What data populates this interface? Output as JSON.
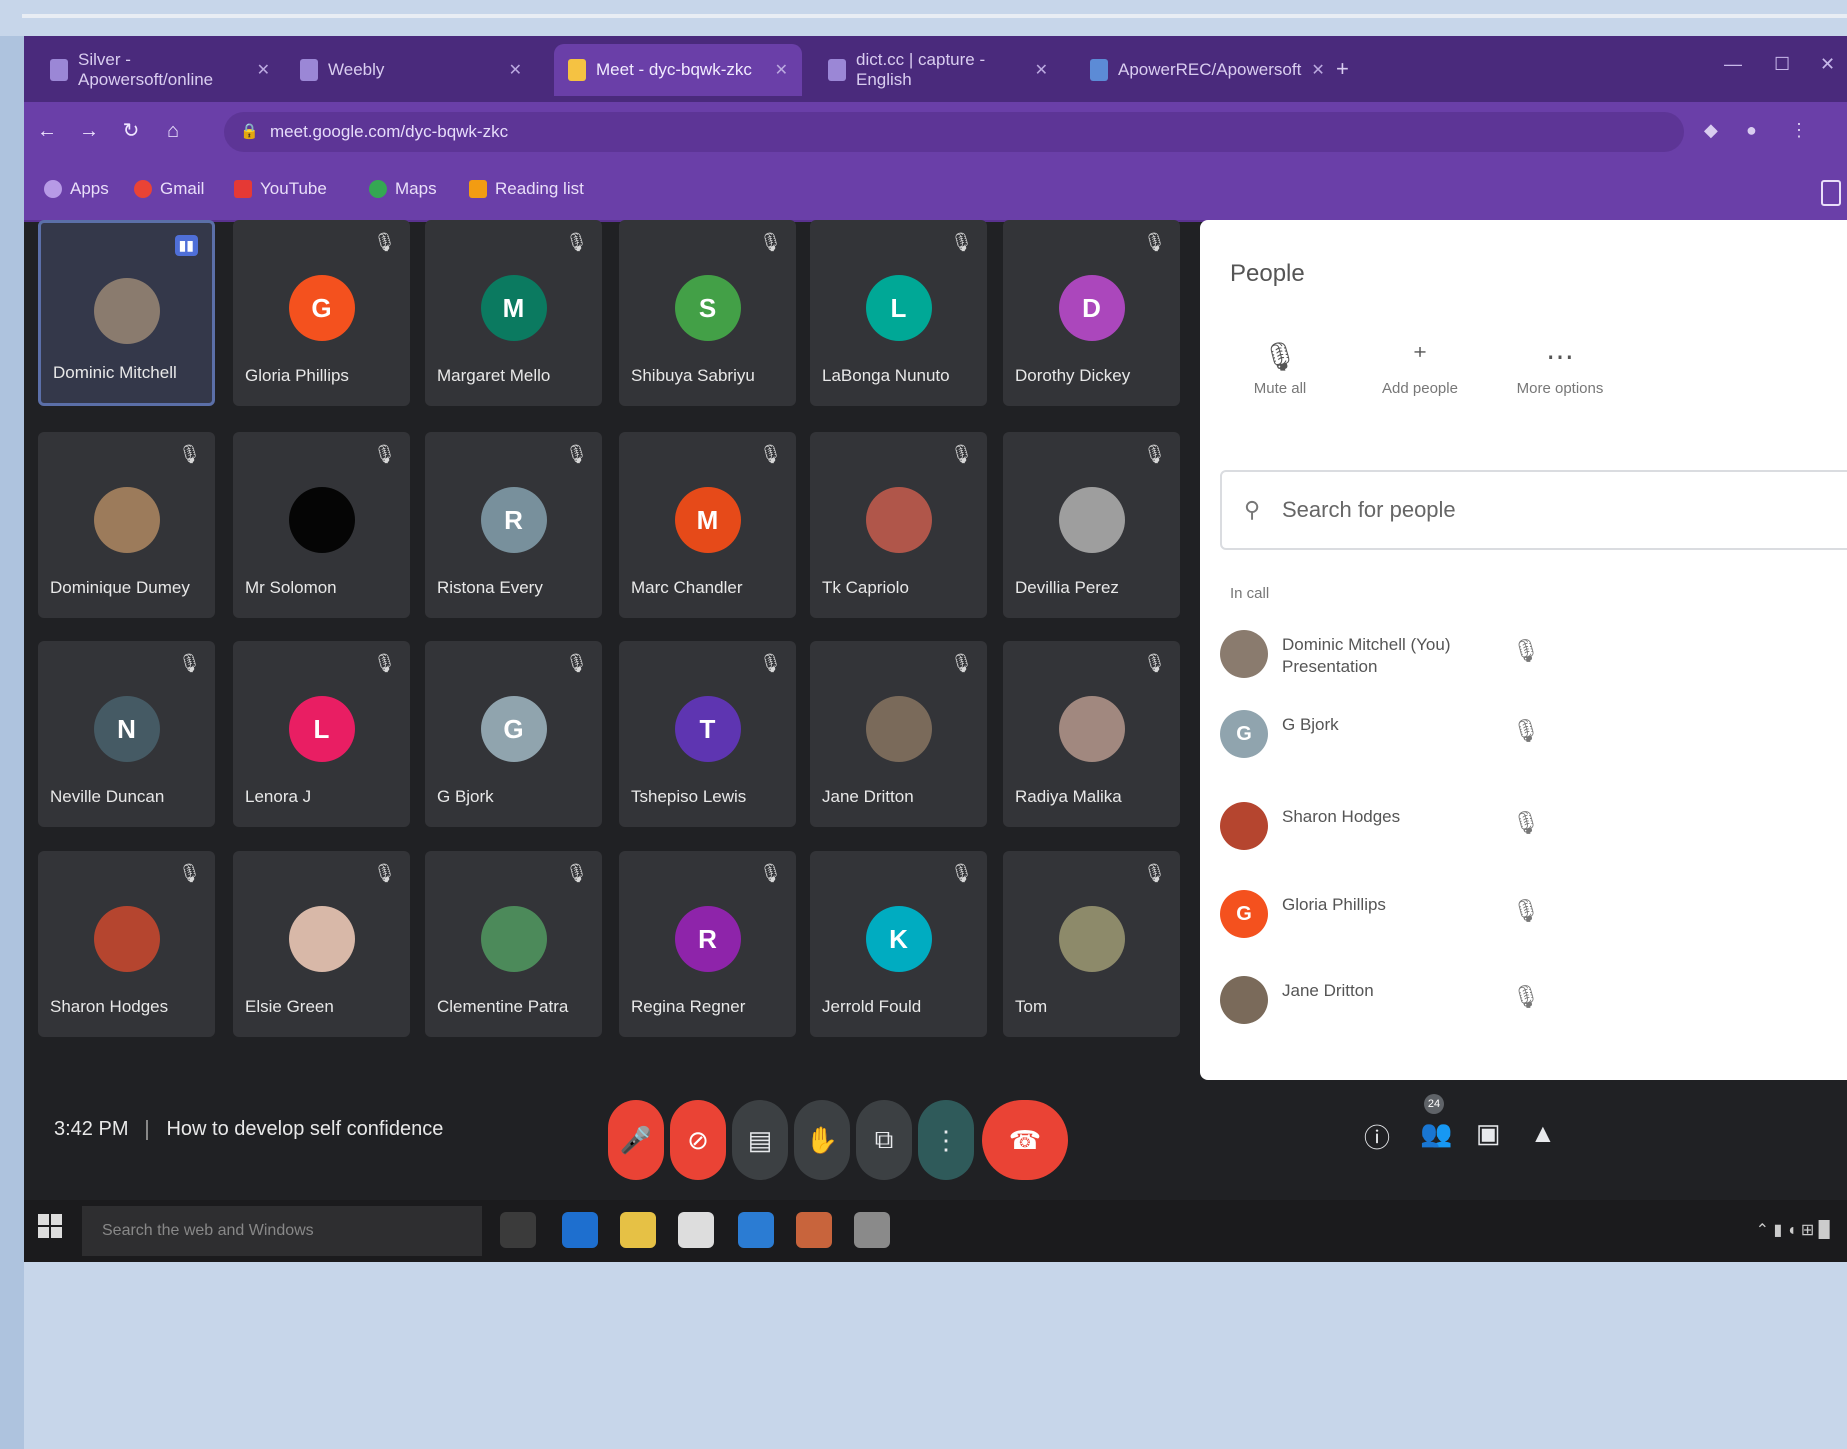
{
  "browser": {
    "tabs": [
      {
        "label": "Silver - Apowersoft/online"
      },
      {
        "label": "Weebly"
      },
      {
        "label": "Meet - dyc-bqwk-zkc",
        "active": true
      },
      {
        "label": "dict.cc | capture - English"
      },
      {
        "label": "ApowerREC/Apowersoft"
      }
    ],
    "url": "meet.google.com/dyc-bqwk-zkc",
    "bookmarks": [
      "Apps",
      "Gmail",
      "YouTube",
      "Maps",
      "Reading list"
    ]
  },
  "tiles": [
    {
      "name": "Dominic Mitchell",
      "initial": "",
      "color": "#8a7b6e",
      "selected": true
    },
    {
      "name": "Gloria Phillips",
      "initial": "G",
      "color": "#f4511e"
    },
    {
      "name": "Margaret Mello",
      "initial": "M",
      "color": "#0b7a60"
    },
    {
      "name": "Shibuya Sabriyu",
      "initial": "S",
      "color": "#43a047"
    },
    {
      "name": "LaBonga Nunuto",
      "initial": "L",
      "color": "#00a896"
    },
    {
      "name": "Dorothy Dickey",
      "initial": "D",
      "color": "#ab47bc"
    },
    {
      "name": "Dominique Dumey",
      "initial": "",
      "color": "#9c7b5b"
    },
    {
      "name": "Mr Solomon",
      "initial": "",
      "color": "#050505"
    },
    {
      "name": "Ristona Every",
      "initial": "R",
      "color": "#78909c"
    },
    {
      "name": "Marc Chandler",
      "initial": "M",
      "color": "#e64a19"
    },
    {
      "name": "Tk Capriolo",
      "initial": "",
      "color": "#b0564a"
    },
    {
      "name": "Devillia Perez",
      "initial": "",
      "color": "#9e9e9e"
    },
    {
      "name": "Neville Duncan",
      "initial": "N",
      "color": "#455a64"
    },
    {
      "name": "Lenora J",
      "initial": "L",
      "color": "#e91e63"
    },
    {
      "name": "G Bjork",
      "initial": "G",
      "color": "#90a4ae"
    },
    {
      "name": "Tshepiso Lewis",
      "initial": "T",
      "color": "#5e35b1"
    },
    {
      "name": "Jane Dritton",
      "initial": "",
      "color": "#7a6a5a"
    },
    {
      "name": "Radiya Malika",
      "initial": "",
      "color": "#a1887f"
    },
    {
      "name": "Sharon Hodges",
      "initial": "",
      "color": "#b5452f"
    },
    {
      "name": "Elsie Green",
      "initial": "",
      "color": "#d8b8a8"
    },
    {
      "name": "Clementine Patra",
      "initial": "",
      "color": "#4c8a5a"
    },
    {
      "name": "Regina Regner",
      "initial": "R",
      "color": "#8e24aa"
    },
    {
      "name": "Jerrold Fould",
      "initial": "K",
      "color": "#00acc1"
    },
    {
      "name": "Tom",
      "initial": "",
      "color": "#8d8a6a"
    }
  ],
  "panel": {
    "title": "People",
    "actions": [
      {
        "icon": "mic-off",
        "label": "Mute all"
      },
      {
        "icon": "add-people",
        "label": "Add people"
      },
      {
        "icon": "more",
        "label": "More options"
      }
    ],
    "search_placeholder": "Search for people",
    "section": "In call",
    "people": [
      {
        "name": "Dominic Mitchell (You) Presentation",
        "initial": "",
        "color": "#8a7b6e"
      },
      {
        "name": "G Bjork",
        "initial": "G",
        "color": "#90a4ae"
      },
      {
        "name": "Sharon Hodges",
        "initial": "",
        "color": "#b5452f"
      },
      {
        "name": "Gloria Phillips",
        "initial": "G",
        "color": "#f4511e"
      },
      {
        "name": "Jane Dritton",
        "initial": "",
        "color": "#7a6a5a"
      }
    ]
  },
  "controls": {
    "time": "3:42 PM",
    "meeting": "How to develop self confidence",
    "participants": "24"
  },
  "taskbar": {
    "search_placeholder": "Search the web and Windows"
  }
}
